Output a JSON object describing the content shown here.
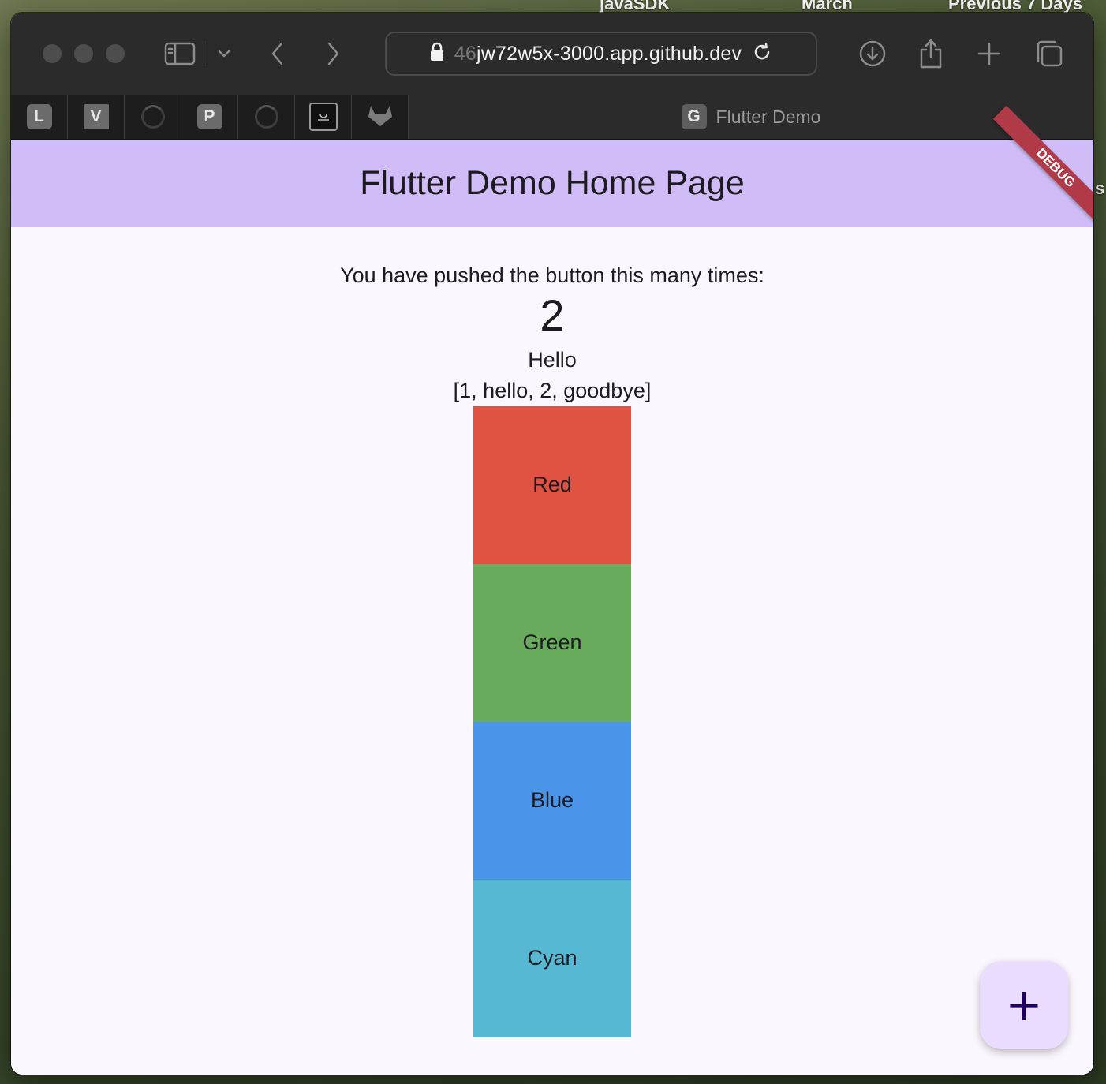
{
  "desktop": {
    "top_labels": [
      "javaSDK",
      "March",
      "Previous 7 Days"
    ],
    "side_label": "s"
  },
  "browser": {
    "url_faded": "46",
    "url_main": "jw72w5x-3000.app.github.dev",
    "pinned_tabs": [
      "L",
      "V",
      "P"
    ],
    "active_tab": {
      "favicon": "G",
      "title": "Flutter Demo"
    }
  },
  "app": {
    "title": "Flutter Demo Home Page",
    "debug_label": "DEBUG",
    "message": "You have pushed the button this many times:",
    "counter": "2",
    "hello": "Hello",
    "list_text": "[1, hello, 2, goodbye]",
    "boxes": [
      {
        "label": "Red",
        "color": "#e05343"
      },
      {
        "label": "Green",
        "color": "#69ab5c"
      },
      {
        "label": "Blue",
        "color": "#4a94ea"
      },
      {
        "label": "Cyan",
        "color": "#56b8d2"
      }
    ],
    "fab_icon": "plus-icon",
    "fab_symbol": "+"
  }
}
